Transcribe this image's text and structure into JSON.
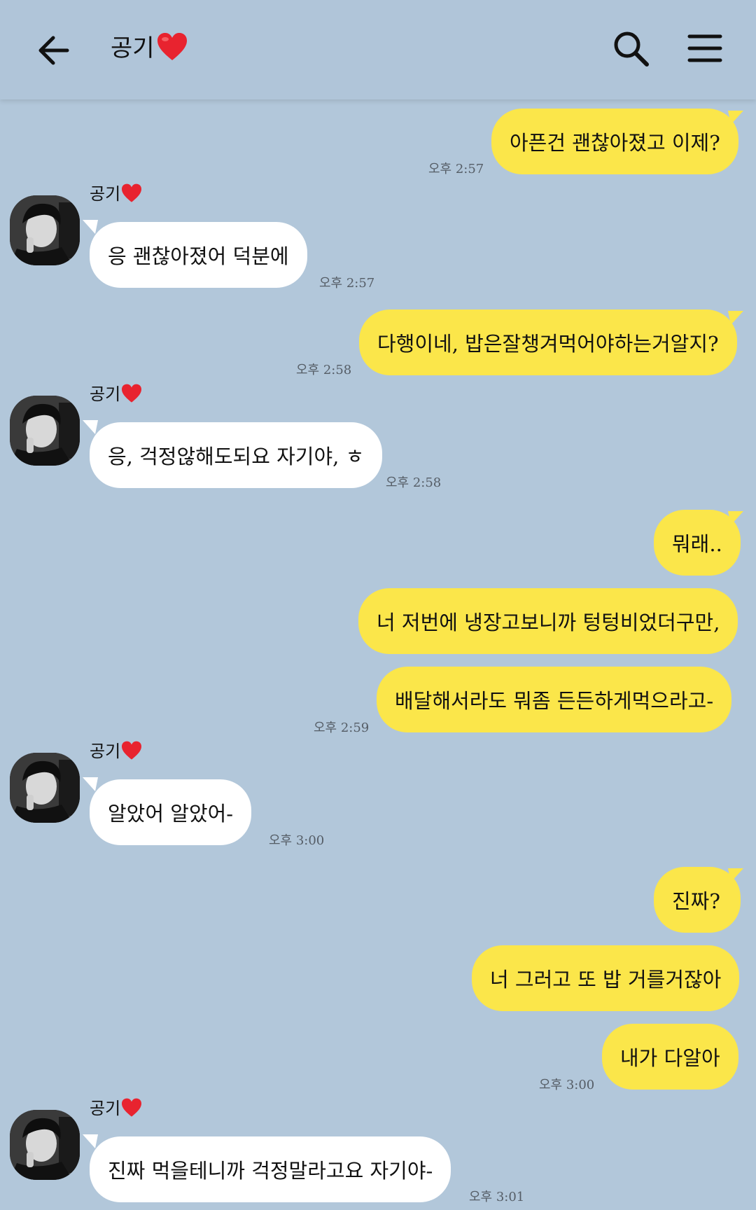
{
  "header": {
    "title": "공기",
    "back_icon": "arrow-left-icon",
    "search_icon": "search-icon",
    "menu_icon": "hamburger-menu-icon",
    "heart_color": "#e8232f"
  },
  "colors": {
    "background": "#b2c7da",
    "my_bubble": "#fbe64a",
    "their_bubble": "#ffffff"
  },
  "contact_name": "공기",
  "messages": [
    {
      "from": "me",
      "text": "아픈건 괜찮아졌고 이제?",
      "time": "오후 2:57"
    },
    {
      "from": "them",
      "text": "응 괜찮아졌어 덕분에",
      "time": "오후 2:57"
    },
    {
      "from": "me",
      "text": "다행이네, 밥은잘챙겨먹어야하는거알지?",
      "time": "오후 2:58"
    },
    {
      "from": "them",
      "text": "응, 걱정않해도되요 자기야, ㅎ",
      "time": "오후 2:58"
    },
    {
      "from": "me",
      "text": "뭐래..",
      "time": ""
    },
    {
      "from": "me",
      "text": "너 저번에 냉장고보니까 텅텅비었더구만,",
      "time": ""
    },
    {
      "from": "me",
      "text": "배달해서라도 뭐좀 든든하게먹으라고-",
      "time": "오후 2:59"
    },
    {
      "from": "them",
      "text": "알았어 알았어-",
      "time": "오후 3:00"
    },
    {
      "from": "me",
      "text": "진짜?",
      "time": ""
    },
    {
      "from": "me",
      "text": "너 그러고 또 밥 거를거잖아",
      "time": ""
    },
    {
      "from": "me",
      "text": "내가 다알아",
      "time": "오후 3:00"
    },
    {
      "from": "them",
      "text": "진짜 먹을테니까 걱정말라고요 자기야-",
      "time": "오후 3:01"
    }
  ]
}
